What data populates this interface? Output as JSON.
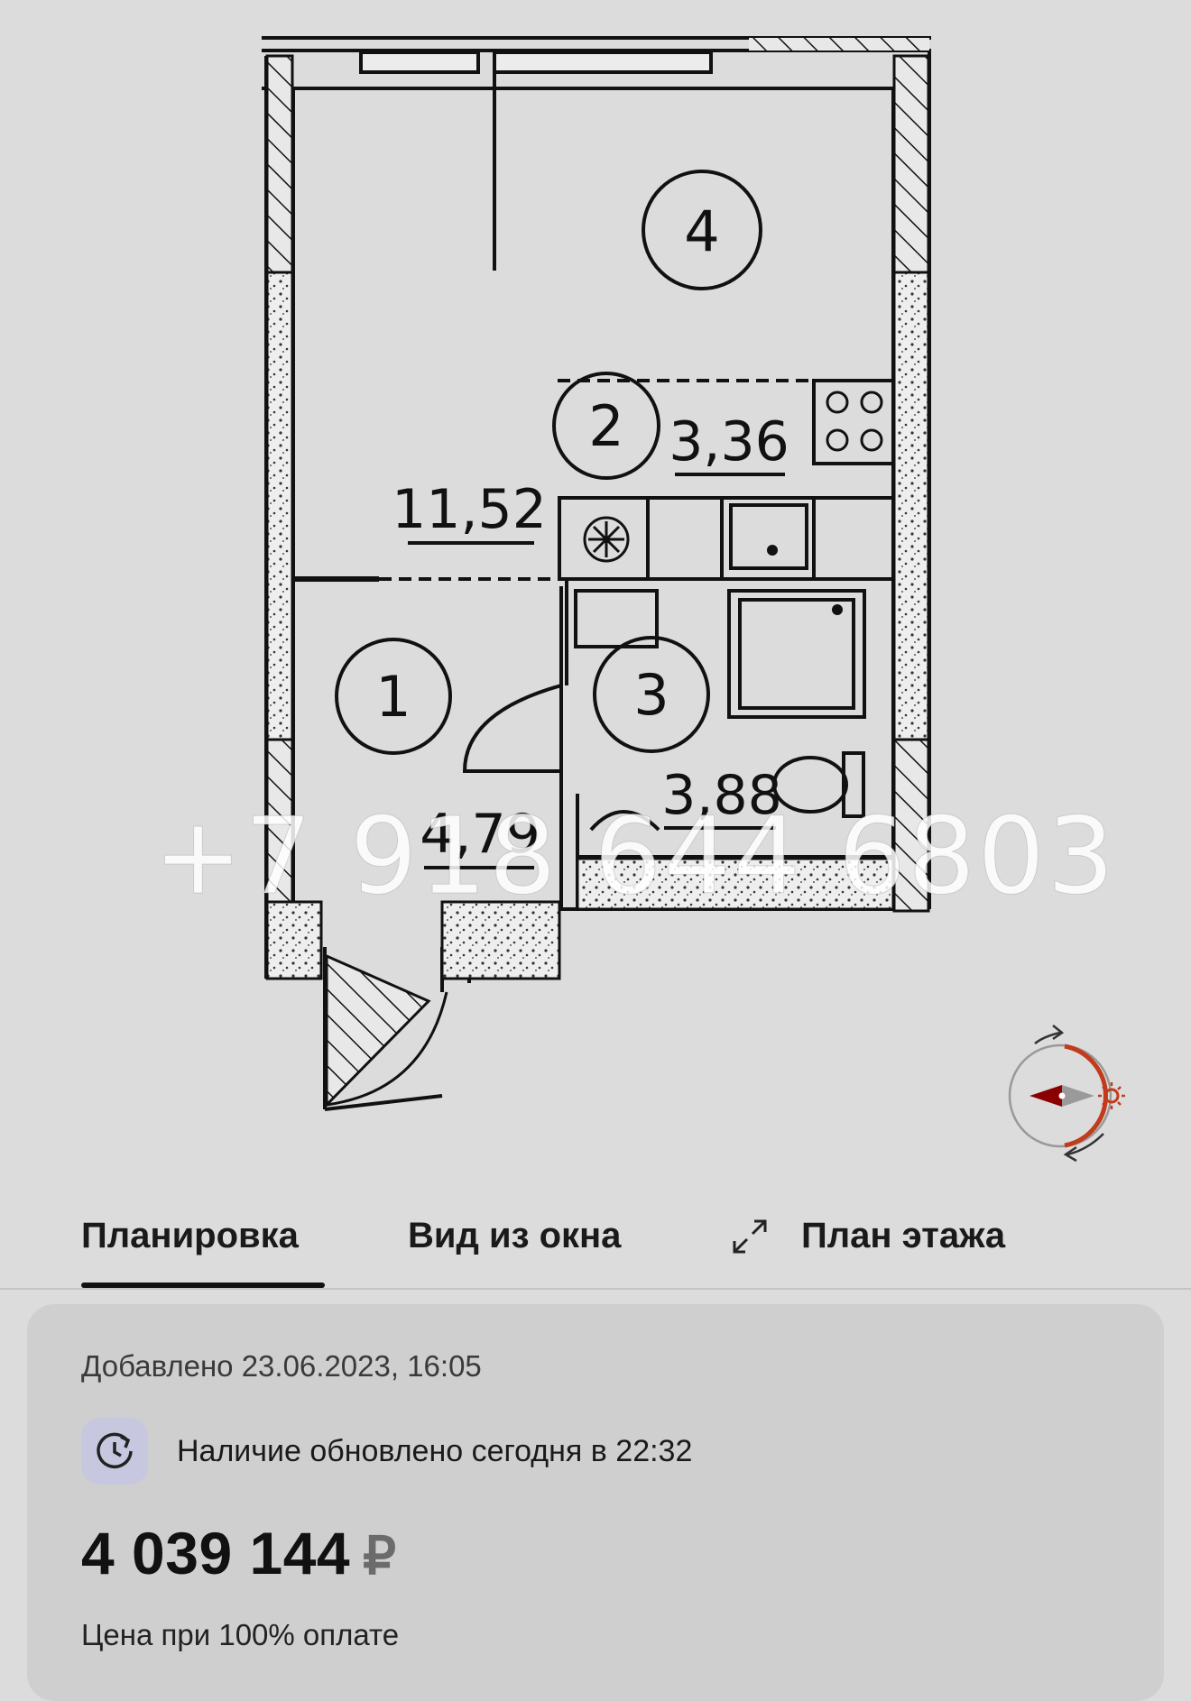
{
  "floor_plan": {
    "rooms": [
      {
        "number": "1",
        "area": "4,79"
      },
      {
        "number": "2",
        "area": "3,36"
      },
      {
        "number": "3",
        "area": "3,88"
      },
      {
        "number": "4",
        "area": "11,52"
      }
    ]
  },
  "watermark": "+7 918 644 6803",
  "tabs": [
    {
      "label": "Планировка",
      "active": true
    },
    {
      "label": "Вид из окна",
      "active": false
    },
    {
      "label": "План этажа",
      "active": false
    }
  ],
  "listing": {
    "added": "Добавлено 23.06.2023, 16:05",
    "availability": "Наличие обновлено сегодня в 22:32",
    "price": "4 039 144",
    "currency": "₽",
    "price_note": "Цена при 100% оплате"
  },
  "icons": {
    "compass": "compass-icon",
    "sun": "sun-icon",
    "expand": "expand-icon",
    "clock": "clock-refresh-icon"
  },
  "colors": {
    "background": "#dcdcdc",
    "card": "#cfcfcf",
    "compass_accent": "#c23b1a",
    "compass_needle": "#8b0000",
    "clock_badge": "#c7c8df"
  }
}
